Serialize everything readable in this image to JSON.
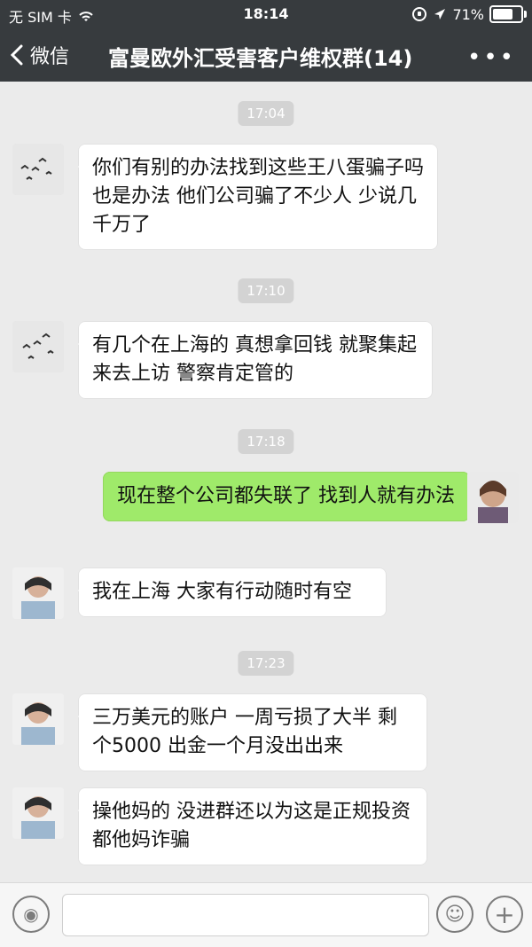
{
  "status": {
    "carrier": "无 SIM 卡",
    "time": "18:14",
    "battery": "71%"
  },
  "nav": {
    "back_label": "微信",
    "title": "富曼欧外汇受害客户维权群(14)"
  },
  "chat": {
    "times": [
      "17:04",
      "17:10",
      "17:18",
      "17:23"
    ],
    "messages": [
      {
        "text": "你们有别的办法找到这些王八蛋骗子吗 也是办法 他们公司骗了不少人 少说几千万了"
      },
      {
        "text": "有几个在上海的 真想拿回钱 就聚集起来去上访 警察肯定管的"
      },
      {
        "text": "现在整个公司都失联了 找到人就有办法"
      },
      {
        "text": "我在上海 大家有行动随时有空"
      },
      {
        "text": "三万美元的账户 一周亏损了大半 剩个5000 出金一个月没出出来"
      },
      {
        "text": "操他妈的 没进群还以为这是正规投资 都他妈诈骗"
      }
    ]
  },
  "input": {
    "placeholder": ""
  },
  "colors": {
    "topbar": "#373b3e",
    "bubble_self": "#9fea6a",
    "bubble_other": "#ffffff",
    "background": "#ebebeb"
  }
}
